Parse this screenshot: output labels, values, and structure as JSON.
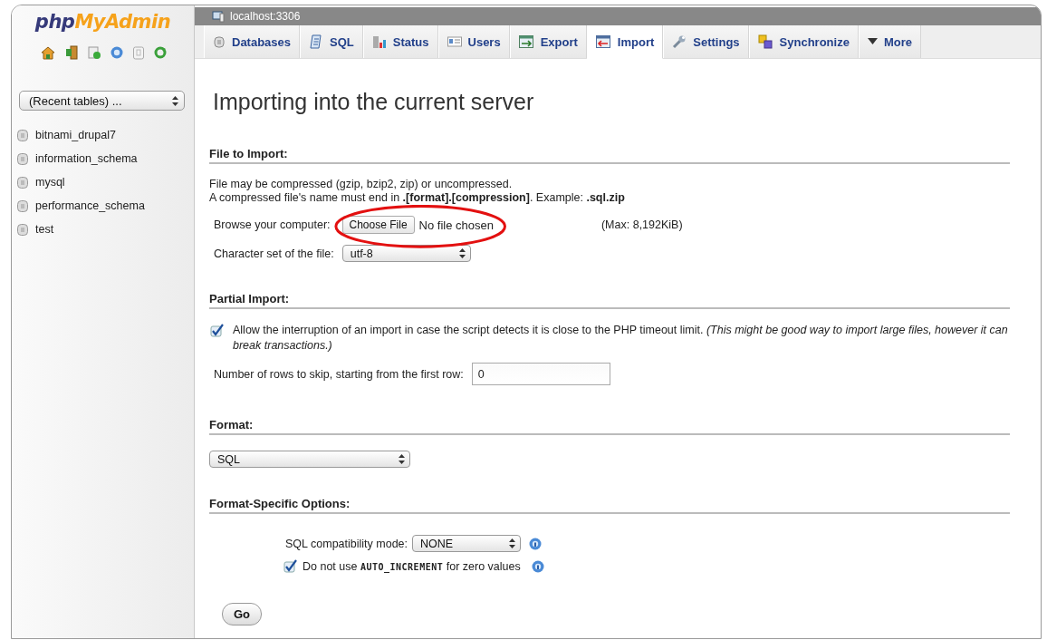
{
  "logo": {
    "first": "php",
    "second": "MyAdmin"
  },
  "sidebar": {
    "recent_tables": {
      "value": "(Recent tables) ..."
    },
    "databases": [
      {
        "name": "bitnami_drupal7"
      },
      {
        "name": "information_schema"
      },
      {
        "name": "mysql"
      },
      {
        "name": "performance_schema"
      },
      {
        "name": "test"
      }
    ]
  },
  "server_bar": {
    "title": "localhost:3306"
  },
  "tabs": [
    {
      "label": "Databases",
      "selected": false
    },
    {
      "label": "SQL",
      "selected": false
    },
    {
      "label": "Status",
      "selected": false
    },
    {
      "label": "Users",
      "selected": false
    },
    {
      "label": "Export",
      "selected": false
    },
    {
      "label": "Import",
      "selected": true
    },
    {
      "label": "Settings",
      "selected": false
    },
    {
      "label": "Synchronize",
      "selected": false
    },
    {
      "label": "More",
      "selected": false
    }
  ],
  "page_title": "Importing into the current server",
  "file_section": {
    "heading": "File to Import:",
    "notes": [
      "File may be compressed (gzip, bzip2, zip) or uncompressed.",
      "A compressed file's name must end in **.[format].[compression]**. Example: **.sql.zip**"
    ],
    "browse_label": "Browse your computer:",
    "choose_button": "Choose File",
    "no_file": "No file chosen",
    "max_size": "(Max: 8,192KiB)",
    "charset_label": "Character set of the file:",
    "charset_value": "utf-8"
  },
  "highlight": {
    "kind": "ellipse"
  },
  "partial_section": {
    "heading": "Partial Import:",
    "allow_interrupt": {
      "checked": true,
      "text": "Allow the interruption of an import in case the script detects it is close to the PHP timeout limit. *(This might be good way to import large files, however it can break transactions.)*"
    },
    "skip_label": "Number of rows to skip, starting from the first row:",
    "skip_value": "0"
  },
  "format_section": {
    "heading": "Format:",
    "format_value": "SQL"
  },
  "options_section": {
    "heading": "Format-Specific Options:",
    "compat_label": "SQL compatibility mode:",
    "compat_value": "NONE",
    "auto_increment": {
      "checked": true,
      "text_before": "Do not use",
      "code": "AUTO_INCREMENT",
      "text_after": "for zero values"
    }
  },
  "go_button": "Go"
}
